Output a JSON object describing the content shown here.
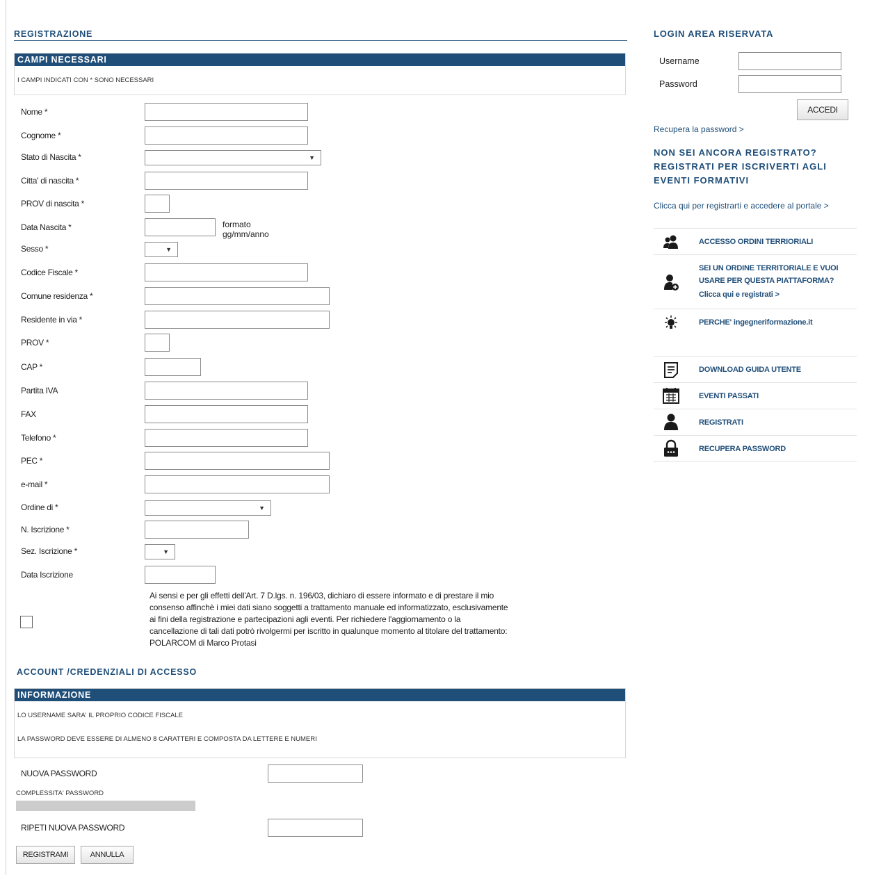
{
  "registration": {
    "title": "REGISTRAZIONE",
    "required_box": {
      "header": "CAMPI NECESSARI",
      "note": "I CAMPI INDICATI CON * SONO NECESSARI"
    },
    "fields": {
      "nome": "Nome *",
      "cognome": "Cognome *",
      "stato_nascita": "Stato di Nascita *",
      "citta_nascita": "Citta' di nascita *",
      "prov_nascita": "PROV di nascita *",
      "data_nascita": "Data Nascita *",
      "data_format_hint": "formato gg/mm/anno",
      "sesso": "Sesso *",
      "codice_fiscale": "Codice Fiscale *",
      "comune_residenza": "Comune residenza *",
      "residente_via": "Residente in via *",
      "prov": "PROV *",
      "cap": "CAP *",
      "partita_iva": "Partita IVA",
      "fax": "FAX",
      "telefono": "Telefono *",
      "pec": "PEC *",
      "email": "e-mail *",
      "ordine": "Ordine di *",
      "n_iscrizione": "N. Iscrizione *",
      "sez_iscrizione": "Sez. Iscrizione *",
      "data_iscrizione": "Data Iscrizione"
    },
    "consent_text": "Ai sensi e per gli effetti dell'Art. 7 D.lgs. n. 196/03, dichiaro di essere informato e di prestare il mio consenso affinchè i miei dati siano soggetti a trattamento manuale ed informatizzato, esclusivamente ai fini della registrazione e partecipazioni agli eventi. Per richiedere l'aggiornamento o la cancellazione di tali dati potrò rivolgermi per iscritto in qualunque momento al titolare del trattamento: POLARCOM di Marco Protasi"
  },
  "account": {
    "title": "ACCOUNT /CREDENZIALI DI ACCESSO",
    "info_box": {
      "header": "INFORMAZIONE",
      "note1": "LO USERNAME SARA' IL PROPRIO CODICE FISCALE",
      "note2": "LA PASSWORD DEVE ESSERE DI ALMENO 8 CARATTERI E COMPOSTA DA LETTERE E NUMERI"
    },
    "new_password_label": "NUOVA PASSWORD",
    "strength_label": "COMPLESSITA' PASSWORD",
    "repeat_password_label": "RIPETI NUOVA PASSWORD",
    "submit_label": "REGISTRAMI",
    "cancel_label": "ANNULLA"
  },
  "sidebar": {
    "login_title": "LOGIN AREA RISERVATA",
    "username_label": "Username",
    "password_label": "Password",
    "login_button": "ACCEDI",
    "recover_link": "Recupera la password >",
    "not_registered_title": "NON SEI ANCORA REGISTRATO? REGISTRATI PER ISCRIVERTI AGLI EVENTI FORMATIVI",
    "register_link": "Clicca qui per registrarti e accedere al portale >",
    "menu": [
      {
        "label": "ACCESSO ORDINI TERRIORIALI",
        "icon": "users-icon"
      },
      {
        "label": "SEI UN ORDINE TERRITORIALE E VUOI USARE PER QUESTA PIATTAFORMA?",
        "sublabel": "Clicca qui e registrati >",
        "icon": "user-add-icon"
      },
      {
        "label": "PERCHE' ingegneriformazione.it",
        "icon": "lightbulb-icon"
      },
      {
        "label": "DOWNLOAD GUIDA UTENTE",
        "icon": "document-icon"
      },
      {
        "label": "EVENTI PASSATI",
        "icon": "calendar-icon"
      },
      {
        "label": "REGISTRATI",
        "icon": "user-icon"
      },
      {
        "label": "RECUPERA PASSWORD",
        "icon": "lock-icon"
      }
    ]
  },
  "colors": {
    "accent": "#1f4e79",
    "bar_text": "#ffffff",
    "strength_bar": "#cccccc"
  }
}
